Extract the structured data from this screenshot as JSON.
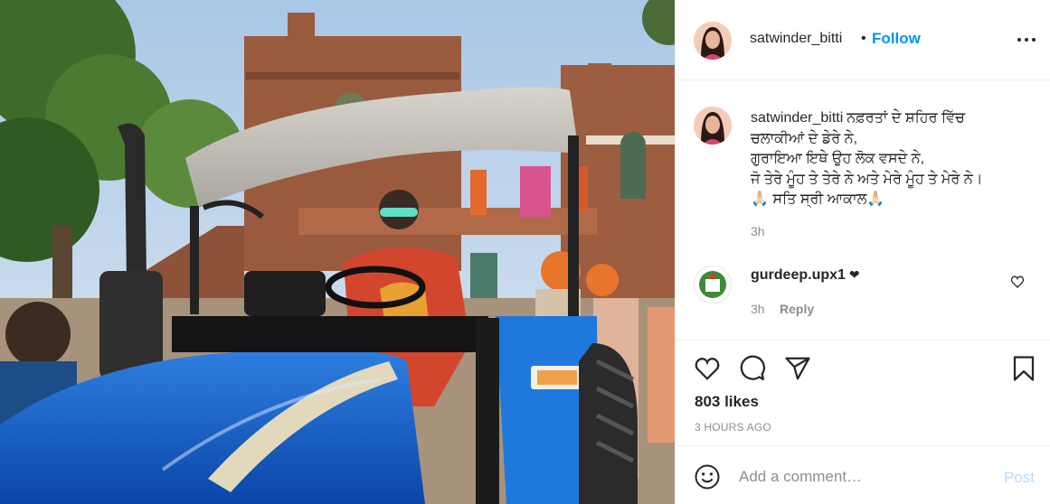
{
  "post": {
    "username": "satwinder_bitti",
    "separator": "•",
    "follow_label": "Follow",
    "more_icon": "more-options-icon"
  },
  "caption": {
    "username": "satwinder_bitti",
    "lines": [
      "ਨਫ਼ਰਤਾਂ ਦੇ ਸ਼ਹਿਰ ਵਿੱਚ",
      "ਚਲਾਕੀਆਂ ਦੇ ਡੇਰੇ ਨੇ,",
      "ਗੁਰਾਇਆ ਇਥੇ ਉਹ ਲੋਕ ਵਸਦੇ ਨੇ,",
      "ਜੋ ਤੇਰੇ ਮੂੰਹ ਤੇ ਤੇਰੇ ਨੇ ਅਤੇ ਮੇਰੇ ਮੂੰਹ ਤੇ ਮੇਰੇ ਨੇ।",
      "🙏🏻 ਸਤਿ ਸ੍ਰੀ ਆਕਾਲ🙏🏻"
    ],
    "time": "3h"
  },
  "reply": {
    "username": "gurdeep.upx1",
    "text": "❤",
    "time": "3h",
    "reply_label": "Reply"
  },
  "actions": {
    "icons": [
      "heart-icon",
      "comment-icon",
      "share-icon",
      "bookmark-icon"
    ],
    "likes": "803 likes",
    "posted": "3 HOURS AGO"
  },
  "add_comment": {
    "placeholder": "Add a comment…",
    "post_label": "Post"
  },
  "colors": {
    "link": "#0095f6",
    "muted": "#8e8e8e",
    "post_disabled": "#b3dbff",
    "text": "#262626"
  }
}
